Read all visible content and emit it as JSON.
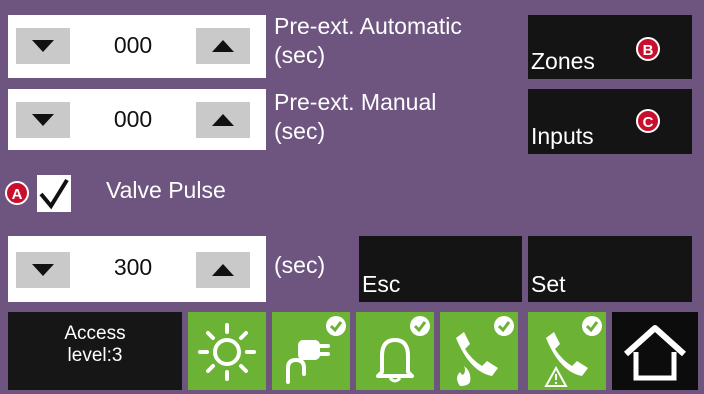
{
  "spinners": [
    {
      "value": "000",
      "label_line1": "Pre-ext. Automatic",
      "label_line2": "(sec)"
    },
    {
      "value": "000",
      "label_line1": "Pre-ext. Manual",
      "label_line2": "(sec)"
    }
  ],
  "valve": {
    "label": "Valve Pulse",
    "checked": true,
    "value": "300",
    "unit": "(sec)"
  },
  "buttons": {
    "zones": "Zones",
    "inputs": "Inputs",
    "esc": "Esc",
    "set": "Set"
  },
  "callouts": {
    "a": "A",
    "b": "B",
    "c": "C"
  },
  "footer": {
    "access_line1": "Access",
    "access_line2": "level:3"
  },
  "status_icons": [
    "sun-icon",
    "power-plug-icon",
    "bell-icon",
    "phone-fire-icon",
    "phone-warning-icon"
  ],
  "colors": {
    "background": "#6e5580",
    "tile_green": "#6bb235",
    "callout_red": "#c8102e",
    "button_dark": "#141414"
  }
}
